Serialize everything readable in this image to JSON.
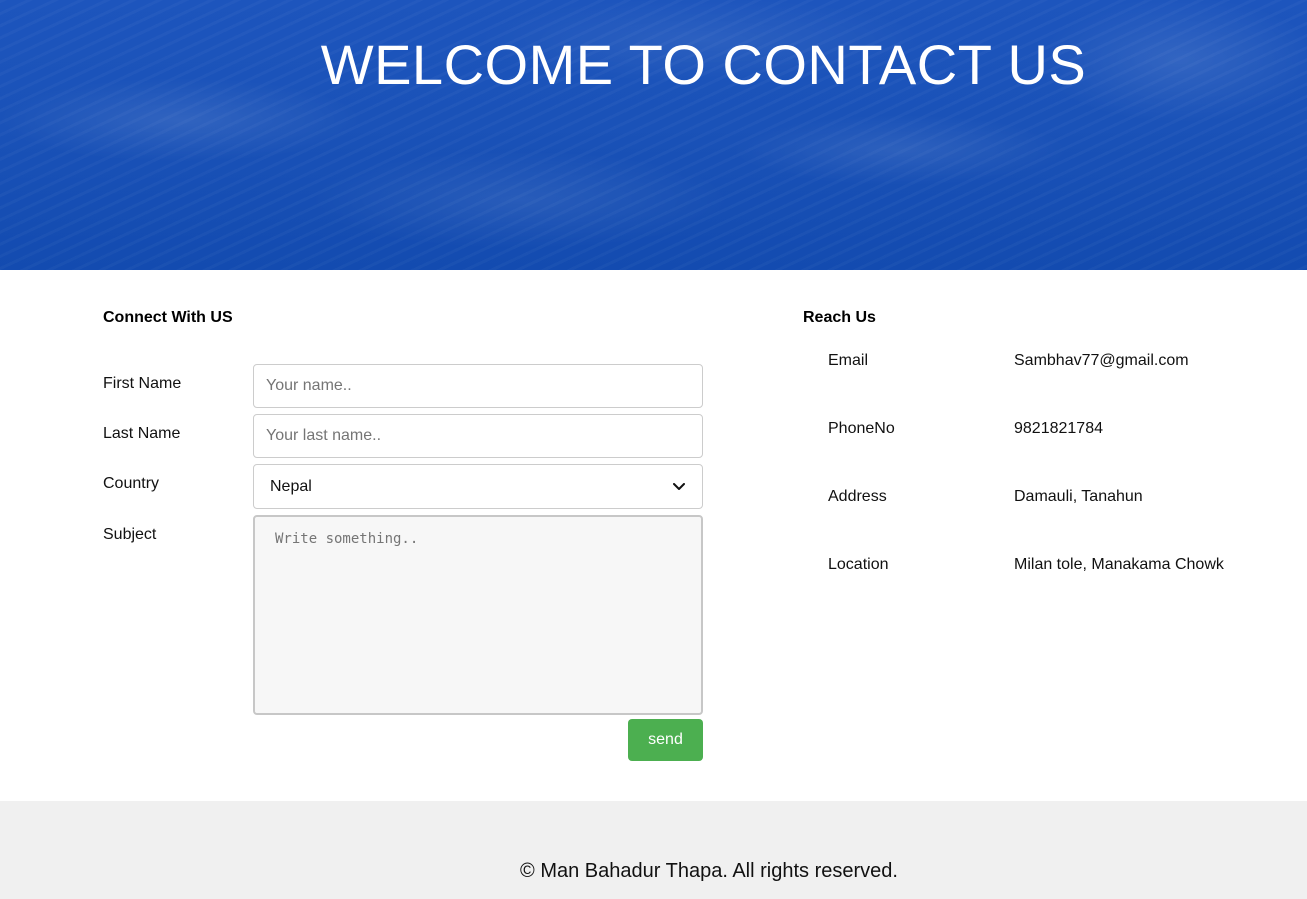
{
  "hero": {
    "title": "WELCOME TO CONTACT US"
  },
  "contact_form": {
    "heading": "Connect With US",
    "first_name": {
      "label": "First Name",
      "value": "",
      "placeholder": "Your name.."
    },
    "last_name": {
      "label": "Last Name",
      "value": "",
      "placeholder": "Your last name.."
    },
    "country": {
      "label": "Country",
      "selected": "Nepal"
    },
    "subject": {
      "label": "Subject",
      "value": "",
      "placeholder": "Write something.."
    },
    "send_label": "send"
  },
  "reach_us": {
    "heading": "Reach Us",
    "items": [
      {
        "label": "Email",
        "value": "Sambhav77@gmail.com"
      },
      {
        "label": "PhoneNo",
        "value": "9821821784"
      },
      {
        "label": "Address",
        "value": "Damauli, Tanahun"
      },
      {
        "label": "Location",
        "value": "Milan tole, Manakama Chowk"
      }
    ]
  },
  "footer": {
    "copyright": "© Man Bahadur Thapa. All rights reserved."
  },
  "colors": {
    "hero_blue": "#1a52b8",
    "send_green": "#4caf50",
    "footer_bg": "#f0f0f0"
  },
  "icons": {
    "select_chevron": "chevron-down-icon"
  }
}
